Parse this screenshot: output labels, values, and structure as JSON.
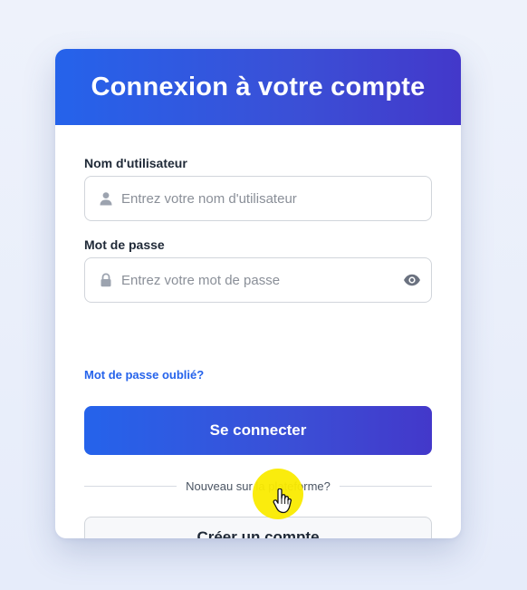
{
  "header": {
    "title": "Connexion à votre compte"
  },
  "form": {
    "username": {
      "label": "Nom d'utilisateur",
      "value": "",
      "placeholder": "Entrez votre nom d'utilisateur",
      "icon": "user-icon"
    },
    "password": {
      "label": "Mot de passe",
      "value": "",
      "placeholder": "Entrez votre mot de passe",
      "icon": "lock-icon",
      "toggle_icon": "eye-icon"
    },
    "forgot_link": "Mot de passe oublié?",
    "submit_label": "Se connecter",
    "divider_text": "Nouveau sur la plateforme?",
    "create_account_label": "Créer un compte"
  },
  "colors": {
    "primary_start": "#2563eb",
    "primary_end": "#4338ca",
    "link": "#2563eb",
    "cursor_highlight": "#faeb00"
  }
}
